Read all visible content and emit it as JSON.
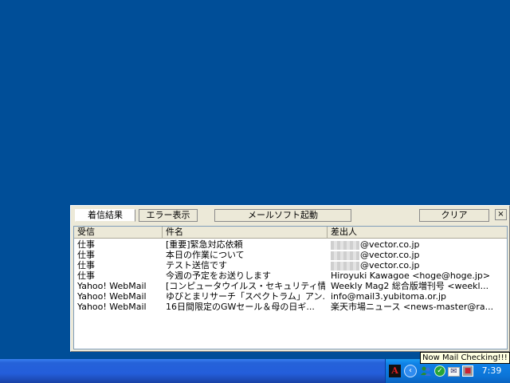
{
  "panel": {
    "tabs": [
      {
        "label": "着信結果"
      },
      {
        "label": "エラー表示"
      }
    ],
    "launch_label": "メールソフト起動",
    "clear_label": "クリア",
    "close_label": "×",
    "columns": {
      "account": "受信",
      "subject": "件名",
      "from": "差出人"
    },
    "rows": [
      {
        "account": "仕事",
        "subject": "[重要]緊急対応依頼",
        "from": "@vector.co.jp",
        "masked": true
      },
      {
        "account": "仕事",
        "subject": "本日の作業について",
        "from": "@vector.co.jp",
        "masked": true
      },
      {
        "account": "仕事",
        "subject": "テスト送信です",
        "from": "@vector.co.jp",
        "masked": true
      },
      {
        "account": "仕事",
        "subject": "今週の予定をお送りします",
        "from": "Hiroyuki Kawagoe <hoge@hoge.jp>",
        "masked": false
      },
      {
        "account": "Yahoo! WebMail",
        "subject": "[コンピュータウイルス・セキュリティ情...",
        "from": "Weekly Mag2 総合版増刊号 <weekl...",
        "masked": false
      },
      {
        "account": "Yahoo! WebMail",
        "subject": "ゆびとまリサーチ「スペクトラム」アン...",
        "from": "info@mail3.yubitoma.or.jp",
        "masked": false
      },
      {
        "account": "Yahoo! WebMail",
        "subject": "16日間限定のGWセール＆母の日ギ...",
        "from": "楽天市場ニュース <news-master@ra...",
        "masked": false
      }
    ]
  },
  "taskbar": {
    "tooltip": "Now Mail Checking!!!",
    "clock": "7:39",
    "tray_icons": [
      "adobe-icon",
      "chevron-left-icon",
      "msn-icon",
      "check-icon",
      "mail-icon",
      "square-icon"
    ]
  }
}
